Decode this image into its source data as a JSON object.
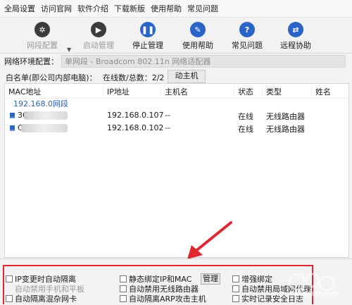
{
  "menubar": {
    "items": [
      "全局设置",
      "访问官网",
      "软件介绍",
      "下载新版",
      "使用帮助",
      "常见问题"
    ]
  },
  "toolbar": {
    "buttons": [
      {
        "label": "网段配置",
        "icon": "gear-icon",
        "color": "#3b3b3b"
      },
      {
        "label": "启动管理",
        "icon": "play-icon",
        "color": "#3b3b3b"
      },
      {
        "label": "停止管理",
        "icon": "pause-icon",
        "color": "#2a64c8"
      },
      {
        "label": "使用帮助",
        "icon": "help-book-icon",
        "color": "#2a64c8"
      },
      {
        "label": "常见问题",
        "icon": "question-icon",
        "color": "#2a64c8"
      },
      {
        "label": "远程协助",
        "icon": "remote-assist-icon",
        "color": "#2a64c8"
      }
    ]
  },
  "network": {
    "label": "网络环境配置：",
    "value": "单网段 - Broadcom 802.11n 网络适配器"
  },
  "whitelist": {
    "label": "白名单(即公司内部电脑)：",
    "count": "在线数/总数：2/2",
    "tab": "动主机"
  },
  "table": {
    "columns": [
      "MAC地址",
      "IP地址",
      "主机名",
      "状态",
      "类型",
      "姓名"
    ],
    "group": "192.168.0网段",
    "rows": [
      {
        "mac": "3C",
        "ip": "192.168.0.107",
        "host": "--",
        "status": "在线",
        "type": "无线路由器",
        "name": ""
      },
      {
        "mac": "C",
        "ip": "192.168.0.102",
        "host": "--",
        "status": "在线",
        "type": "无线路由器",
        "name": ""
      }
    ]
  },
  "options": {
    "ip_change_isolate": "IP变更时自动隔离",
    "auto_block_mobile": "自动禁用手机和平板",
    "auto_isolate_promiscuous": "自动隔离混杂网卡",
    "static_bind": "静态绑定IP和MAC",
    "manage_btn": "管理",
    "block_wireless_router": "自动禁用无线路由器",
    "isolate_arp": "自动隔离ARP攻击主机",
    "enhanced_bind": "增强绑定",
    "auto_block_lan_proxy": "自动禁用局域网代理",
    "realtime_log": "实时记录安全日志"
  },
  "colors": {
    "annotation_red": "#e0262f",
    "group_blue": "#2b62b8"
  }
}
